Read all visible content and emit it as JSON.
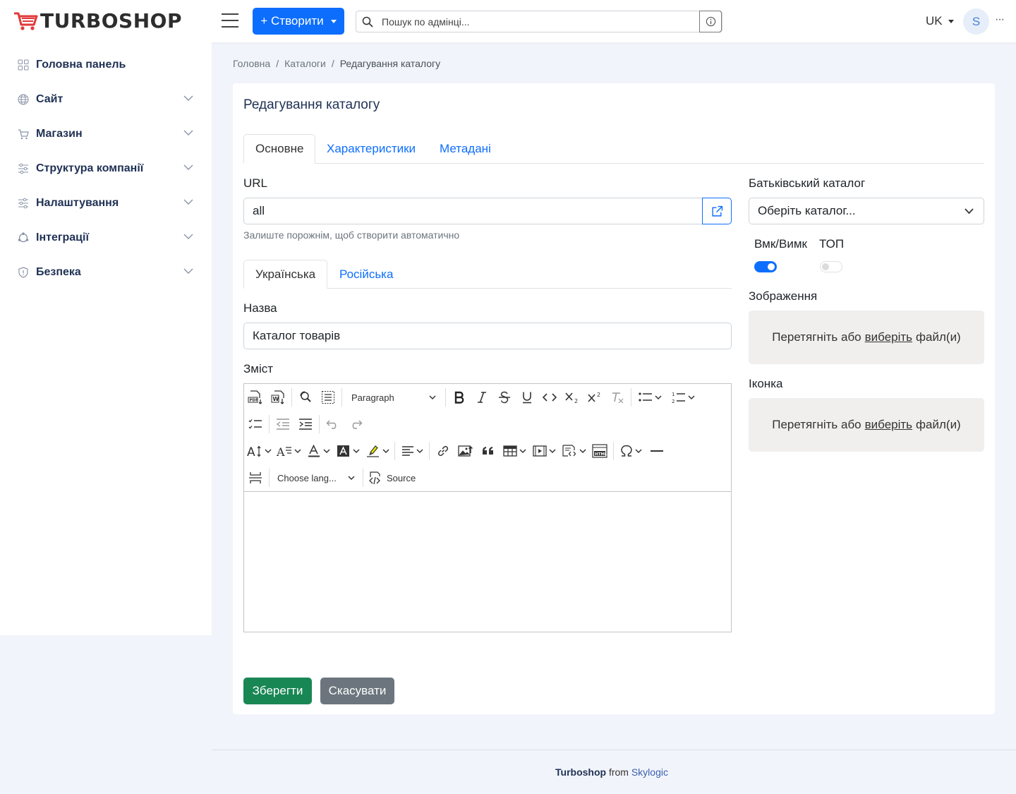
{
  "header": {
    "logo_text": "TURBOSHOP",
    "create_label": "+ Створити",
    "search_placeholder": "Пошук по адмінці...",
    "lang": "UK",
    "avatar_initial": "S",
    "more": "···"
  },
  "sidebar": {
    "items": [
      {
        "label": "Головна панель",
        "icon": "dashboard-icon"
      },
      {
        "label": "Сайт",
        "icon": "globe-icon"
      },
      {
        "label": "Магазин",
        "icon": "cart-icon"
      },
      {
        "label": "Структура компанії",
        "icon": "sliders-icon"
      },
      {
        "label": "Налаштування",
        "icon": "settings-sliders-icon"
      },
      {
        "label": "Інтеграції",
        "icon": "integrations-icon"
      },
      {
        "label": "Безпека",
        "icon": "shield-icon"
      }
    ]
  },
  "breadcrumb": {
    "home": "Головна",
    "catalogs": "Каталоги",
    "current": "Редагування каталогу",
    "sep": "/"
  },
  "page": {
    "title": "Редагування каталогу",
    "tabs": [
      "Основне",
      "Характеристики",
      "Метадані"
    ],
    "url_label": "URL",
    "url_value": "all",
    "url_hint": "Залиште порожнім, щоб створити автоматично",
    "lang_tabs": [
      "Українська",
      "Російська"
    ],
    "name_label": "Назва",
    "name_value": "Каталог товарів",
    "content_label": "Зміст",
    "editor": {
      "paragraph": "Paragraph",
      "choose_lang": "Choose lang...",
      "source": "Source",
      "content": ""
    },
    "parent_label": "Батьківський каталог",
    "parent_placeholder": "Оберіть каталог...",
    "enabled_label": "Вмк/Вимк",
    "enabled_value": true,
    "top_label": "ТОП",
    "top_value": false,
    "image_label": "Зображення",
    "icon_label": "Іконка",
    "drop_before": "Перетягніть або",
    "drop_link": "виберіть",
    "drop_after": "файл(и)",
    "save_label": "Зберегти",
    "cancel_label": "Скасувати"
  },
  "footer": {
    "brand": "Turboshop",
    "from": "from",
    "company": "Skylogic"
  },
  "colors": {
    "primary": "#0d6efd",
    "success": "#198754",
    "secondary": "#6c757d",
    "logo_cart": "#e23a3a"
  }
}
